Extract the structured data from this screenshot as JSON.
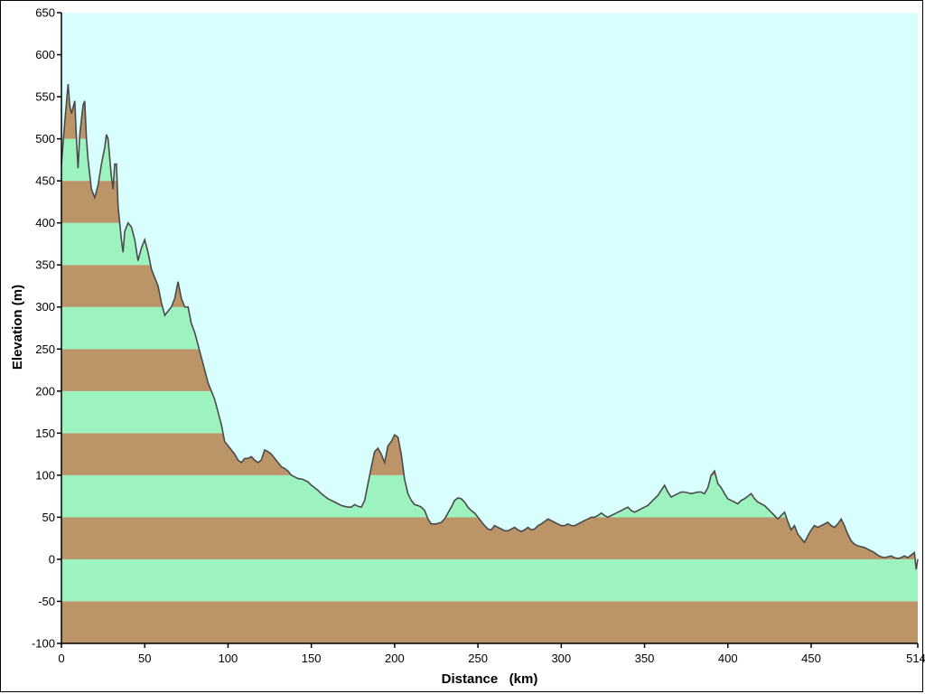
{
  "chart_data": {
    "type": "area",
    "title": "",
    "xlabel": "Distance   (km)",
    "ylabel": "Elevation (m)",
    "xlim": [
      0,
      514
    ],
    "ylim": [
      -100,
      650
    ],
    "x_ticks": [
      "0",
      "50",
      "100",
      "150",
      "200",
      "250",
      "300",
      "350",
      "400",
      "450",
      "514"
    ],
    "y_ticks": [
      "650",
      "600",
      "550",
      "500",
      "450",
      "400",
      "350",
      "300",
      "250",
      "200",
      "150",
      "100",
      "50",
      "0",
      "-50",
      "-100"
    ],
    "band_step": 50,
    "grid": false,
    "legend": "none",
    "colors": {
      "plot_background": "#d9fefe",
      "band_brown": "#bb9468",
      "band_green": "#9cf3c0",
      "profile_line": "#4a4a4a"
    },
    "series": [
      {
        "values": [
          [
            0,
            470
          ],
          [
            2,
            520
          ],
          [
            4,
            565
          ],
          [
            5,
            540
          ],
          [
            6,
            530
          ],
          [
            8,
            545
          ],
          [
            9,
            500
          ],
          [
            10,
            465
          ],
          [
            11,
            505
          ],
          [
            13,
            540
          ],
          [
            14,
            545
          ],
          [
            15,
            500
          ],
          [
            16,
            475
          ],
          [
            18,
            440
          ],
          [
            20,
            430
          ],
          [
            22,
            445
          ],
          [
            24,
            470
          ],
          [
            26,
            490
          ],
          [
            27,
            505
          ],
          [
            28,
            500
          ],
          [
            30,
            455
          ],
          [
            31,
            440
          ],
          [
            32,
            470
          ],
          [
            33,
            470
          ],
          [
            34,
            420
          ],
          [
            36,
            380
          ],
          [
            37,
            365
          ],
          [
            38,
            390
          ],
          [
            40,
            400
          ],
          [
            42,
            395
          ],
          [
            44,
            380
          ],
          [
            46,
            355
          ],
          [
            48,
            370
          ],
          [
            50,
            380
          ],
          [
            52,
            365
          ],
          [
            54,
            345
          ],
          [
            56,
            335
          ],
          [
            58,
            325
          ],
          [
            60,
            305
          ],
          [
            62,
            290
          ],
          [
            64,
            295
          ],
          [
            66,
            300
          ],
          [
            68,
            310
          ],
          [
            70,
            330
          ],
          [
            72,
            310
          ],
          [
            74,
            300
          ],
          [
            76,
            300
          ],
          [
            78,
            280
          ],
          [
            80,
            270
          ],
          [
            82,
            255
          ],
          [
            84,
            240
          ],
          [
            86,
            225
          ],
          [
            88,
            210
          ],
          [
            90,
            200
          ],
          [
            92,
            190
          ],
          [
            94,
            175
          ],
          [
            96,
            160
          ],
          [
            98,
            140
          ],
          [
            100,
            135
          ],
          [
            102,
            130
          ],
          [
            104,
            125
          ],
          [
            106,
            118
          ],
          [
            108,
            115
          ],
          [
            110,
            120
          ],
          [
            112,
            120
          ],
          [
            114,
            122
          ],
          [
            116,
            118
          ],
          [
            118,
            115
          ],
          [
            120,
            118
          ],
          [
            122,
            130
          ],
          [
            124,
            128
          ],
          [
            126,
            125
          ],
          [
            128,
            120
          ],
          [
            130,
            115
          ],
          [
            132,
            110
          ],
          [
            134,
            108
          ],
          [
            136,
            105
          ],
          [
            138,
            100
          ],
          [
            140,
            98
          ],
          [
            142,
            96
          ],
          [
            145,
            95
          ],
          [
            148,
            92
          ],
          [
            150,
            88
          ],
          [
            152,
            85
          ],
          [
            154,
            82
          ],
          [
            156,
            78
          ],
          [
            158,
            75
          ],
          [
            160,
            72
          ],
          [
            162,
            70
          ],
          [
            164,
            68
          ],
          [
            166,
            66
          ],
          [
            168,
            64
          ],
          [
            170,
            63
          ],
          [
            172,
            62
          ],
          [
            174,
            62
          ],
          [
            176,
            65
          ],
          [
            178,
            63
          ],
          [
            180,
            62
          ],
          [
            182,
            70
          ],
          [
            184,
            90
          ],
          [
            186,
            110
          ],
          [
            188,
            128
          ],
          [
            190,
            132
          ],
          [
            192,
            125
          ],
          [
            194,
            115
          ],
          [
            196,
            135
          ],
          [
            198,
            140
          ],
          [
            200,
            148
          ],
          [
            202,
            145
          ],
          [
            204,
            125
          ],
          [
            206,
            95
          ],
          [
            208,
            78
          ],
          [
            210,
            70
          ],
          [
            212,
            65
          ],
          [
            214,
            64
          ],
          [
            216,
            62
          ],
          [
            218,
            58
          ],
          [
            220,
            48
          ],
          [
            222,
            42
          ],
          [
            225,
            42
          ],
          [
            228,
            44
          ],
          [
            230,
            48
          ],
          [
            232,
            55
          ],
          [
            234,
            62
          ],
          [
            236,
            70
          ],
          [
            238,
            73
          ],
          [
            240,
            72
          ],
          [
            242,
            68
          ],
          [
            244,
            62
          ],
          [
            246,
            58
          ],
          [
            248,
            55
          ],
          [
            250,
            50
          ],
          [
            252,
            45
          ],
          [
            254,
            40
          ],
          [
            256,
            36
          ],
          [
            258,
            35
          ],
          [
            260,
            40
          ],
          [
            262,
            38
          ],
          [
            264,
            36
          ],
          [
            266,
            34
          ],
          [
            268,
            34
          ],
          [
            270,
            36
          ],
          [
            272,
            38
          ],
          [
            274,
            35
          ],
          [
            276,
            33
          ],
          [
            278,
            35
          ],
          [
            280,
            38
          ],
          [
            282,
            35
          ],
          [
            284,
            36
          ],
          [
            286,
            40
          ],
          [
            288,
            42
          ],
          [
            290,
            45
          ],
          [
            292,
            48
          ],
          [
            294,
            46
          ],
          [
            296,
            44
          ],
          [
            298,
            42
          ],
          [
            300,
            40
          ],
          [
            302,
            40
          ],
          [
            304,
            42
          ],
          [
            306,
            40
          ],
          [
            308,
            40
          ],
          [
            310,
            42
          ],
          [
            312,
            44
          ],
          [
            314,
            46
          ],
          [
            316,
            48
          ],
          [
            318,
            50
          ],
          [
            320,
            50
          ],
          [
            322,
            52
          ],
          [
            324,
            55
          ],
          [
            326,
            52
          ],
          [
            328,
            50
          ],
          [
            330,
            52
          ],
          [
            332,
            54
          ],
          [
            334,
            56
          ],
          [
            336,
            58
          ],
          [
            338,
            60
          ],
          [
            340,
            62
          ],
          [
            342,
            58
          ],
          [
            344,
            56
          ],
          [
            346,
            58
          ],
          [
            348,
            60
          ],
          [
            350,
            62
          ],
          [
            352,
            64
          ],
          [
            354,
            68
          ],
          [
            356,
            72
          ],
          [
            358,
            76
          ],
          [
            360,
            82
          ],
          [
            362,
            88
          ],
          [
            364,
            80
          ],
          [
            366,
            74
          ],
          [
            368,
            76
          ],
          [
            370,
            78
          ],
          [
            372,
            80
          ],
          [
            374,
            80
          ],
          [
            376,
            79
          ],
          [
            378,
            78
          ],
          [
            380,
            79
          ],
          [
            382,
            80
          ],
          [
            384,
            80
          ],
          [
            386,
            78
          ],
          [
            388,
            85
          ],
          [
            390,
            100
          ],
          [
            392,
            105
          ],
          [
            394,
            90
          ],
          [
            396,
            85
          ],
          [
            398,
            78
          ],
          [
            400,
            72
          ],
          [
            402,
            70
          ],
          [
            404,
            68
          ],
          [
            406,
            66
          ],
          [
            408,
            70
          ],
          [
            410,
            72
          ],
          [
            412,
            75
          ],
          [
            414,
            78
          ],
          [
            416,
            72
          ],
          [
            418,
            68
          ],
          [
            420,
            66
          ],
          [
            422,
            64
          ],
          [
            424,
            60
          ],
          [
            426,
            56
          ],
          [
            428,
            52
          ],
          [
            430,
            48
          ],
          [
            432,
            52
          ],
          [
            434,
            56
          ],
          [
            436,
            45
          ],
          [
            438,
            35
          ],
          [
            440,
            40
          ],
          [
            442,
            30
          ],
          [
            444,
            25
          ],
          [
            446,
            20
          ],
          [
            448,
            28
          ],
          [
            450,
            35
          ],
          [
            452,
            40
          ],
          [
            454,
            38
          ],
          [
            456,
            40
          ],
          [
            458,
            42
          ],
          [
            460,
            44
          ],
          [
            462,
            40
          ],
          [
            464,
            38
          ],
          [
            466,
            42
          ],
          [
            468,
            48
          ],
          [
            470,
            40
          ],
          [
            472,
            30
          ],
          [
            474,
            22
          ],
          [
            476,
            18
          ],
          [
            478,
            16
          ],
          [
            480,
            15
          ],
          [
            482,
            14
          ],
          [
            484,
            12
          ],
          [
            486,
            10
          ],
          [
            488,
            8
          ],
          [
            490,
            5
          ],
          [
            492,
            3
          ],
          [
            494,
            2
          ],
          [
            496,
            3
          ],
          [
            498,
            4
          ],
          [
            500,
            2
          ],
          [
            502,
            1
          ],
          [
            504,
            2
          ],
          [
            506,
            4
          ],
          [
            508,
            2
          ],
          [
            510,
            5
          ],
          [
            512,
            8
          ],
          [
            513,
            -12
          ],
          [
            514,
            0
          ]
        ]
      }
    ]
  }
}
